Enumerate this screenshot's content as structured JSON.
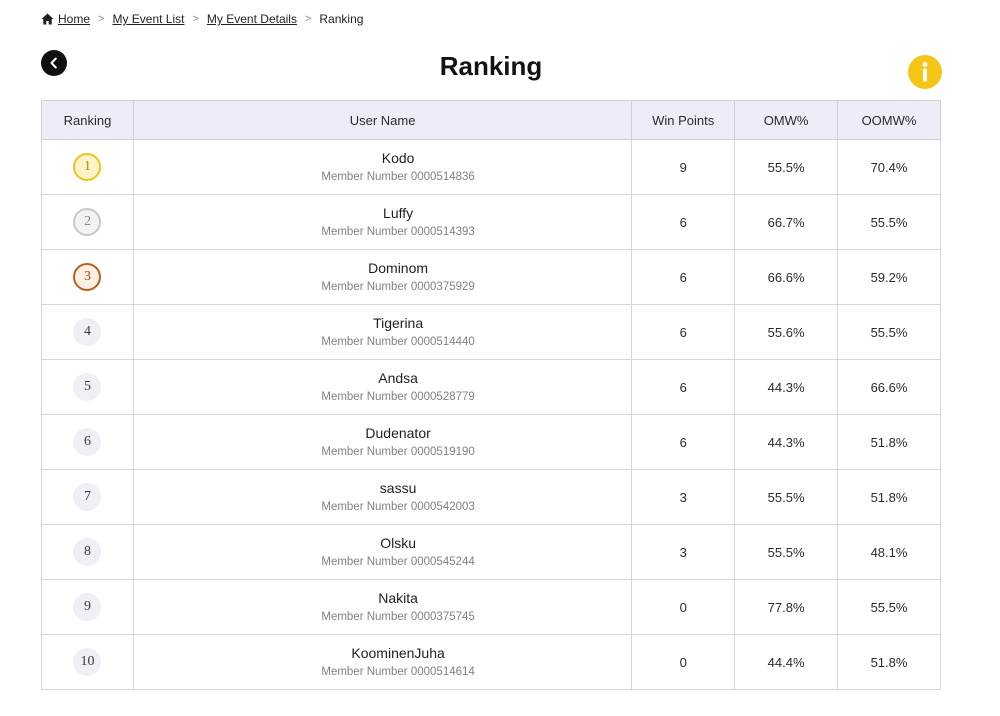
{
  "breadcrumb": {
    "home": "Home",
    "event_list": "My Event List",
    "event_details": "My Event Details",
    "current": "Ranking",
    "separator": ">"
  },
  "page": {
    "title": "Ranking",
    "info_label": "i"
  },
  "table": {
    "headers": {
      "ranking": "Ranking",
      "user_name": "User Name",
      "win_points": "Win Points",
      "omw": "OMW%",
      "oomw": "OOMW%"
    },
    "member_prefix": "Member Number",
    "rows": [
      {
        "rank": "1",
        "name": "Kodo",
        "member": "0000514836",
        "win_points": "9",
        "omw": "55.5%",
        "oomw": "70.4%"
      },
      {
        "rank": "2",
        "name": "Luffy",
        "member": "0000514393",
        "win_points": "6",
        "omw": "66.7%",
        "oomw": "55.5%"
      },
      {
        "rank": "3",
        "name": "Dominom",
        "member": "0000375929",
        "win_points": "6",
        "omw": "66.6%",
        "oomw": "59.2%"
      },
      {
        "rank": "4",
        "name": "Tigerina",
        "member": "0000514440",
        "win_points": "6",
        "omw": "55.6%",
        "oomw": "55.5%"
      },
      {
        "rank": "5",
        "name": "Andsa",
        "member": "0000528779",
        "win_points": "6",
        "omw": "44.3%",
        "oomw": "66.6%"
      },
      {
        "rank": "6",
        "name": "Dudenator",
        "member": "0000519190",
        "win_points": "6",
        "omw": "44.3%",
        "oomw": "51.8%"
      },
      {
        "rank": "7",
        "name": "sassu",
        "member": "0000542003",
        "win_points": "3",
        "omw": "55.5%",
        "oomw": "51.8%"
      },
      {
        "rank": "8",
        "name": "Olsku",
        "member": "0000545244",
        "win_points": "3",
        "omw": "55.5%",
        "oomw": "48.1%"
      },
      {
        "rank": "9",
        "name": "Nakita",
        "member": "0000375745",
        "win_points": "0",
        "omw": "77.8%",
        "oomw": "55.5%"
      },
      {
        "rank": "10",
        "name": "KoominenJuha",
        "member": "0000514614",
        "win_points": "0",
        "omw": "44.4%",
        "oomw": "51.8%"
      }
    ]
  },
  "colors": {
    "gold": "#f2c21c",
    "silver": "#c9c9cc",
    "bronze": "#b8601e",
    "info_button": "#f5c518",
    "header_bg": "#eeedf7"
  },
  "icons": {
    "home": "home-icon",
    "back": "chevron-left-icon",
    "info": "info-icon"
  }
}
